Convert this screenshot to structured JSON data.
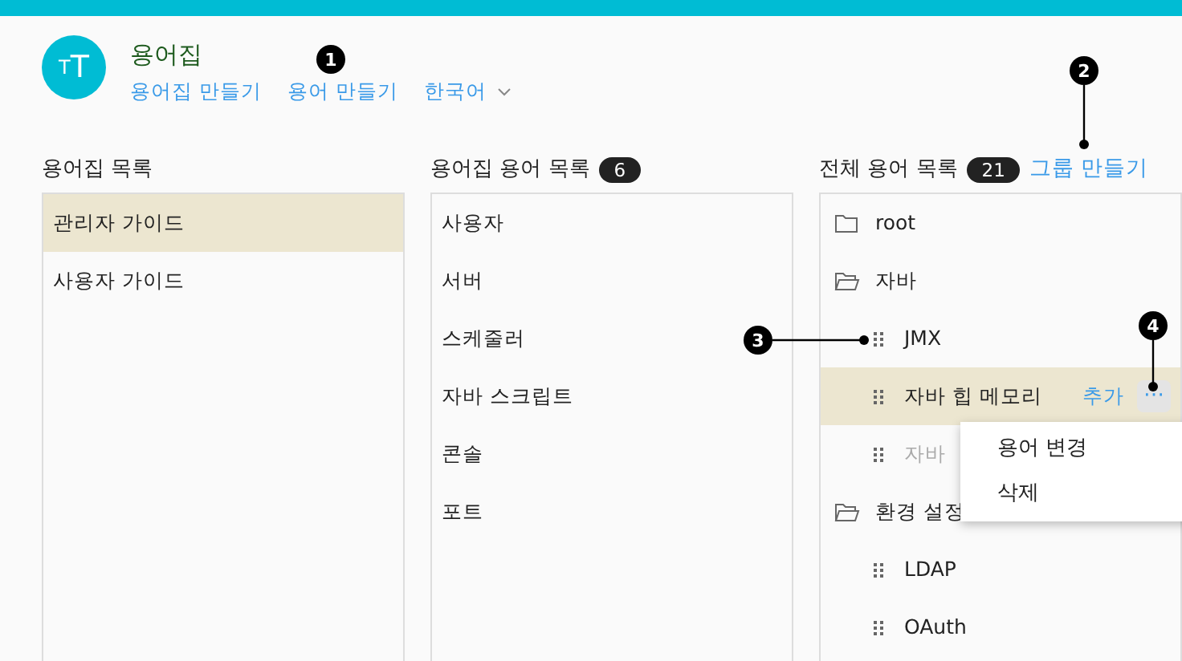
{
  "header": {
    "avatar": "TT",
    "title": "용어집",
    "links": [
      {
        "label": "용어집 만들기",
        "kind": "link"
      },
      {
        "label": "용어 만들기",
        "kind": "link"
      },
      {
        "label": "한국어",
        "kind": "dropdown"
      }
    ]
  },
  "glossary_list": {
    "title": "용어집 목록",
    "items": [
      {
        "label": "관리자 가이드",
        "selected": true
      },
      {
        "label": "사용자 가이드",
        "selected": false
      }
    ]
  },
  "term_list": {
    "title": "용어집 용어 목록",
    "count": "6",
    "items": [
      {
        "label": "사용자",
        "selected": false
      },
      {
        "label": "서버",
        "selected": false
      },
      {
        "label": "스케줄러",
        "selected": false
      },
      {
        "label": "자바 스크립트",
        "selected": false
      },
      {
        "label": "콘솔",
        "selected": false
      },
      {
        "label": "포트",
        "selected": false
      }
    ]
  },
  "all_terms": {
    "title": "전체 용어 목록",
    "count": "21",
    "action": "그룹 만들기",
    "tree": [
      {
        "kind": "folder",
        "label": "root",
        "expanded": false
      },
      {
        "kind": "folder",
        "label": "자바",
        "expanded": true,
        "children": [
          {
            "kind": "term",
            "label": "JMX",
            "selected": false,
            "disabled": false
          },
          {
            "kind": "term",
            "label": "자바 힙 메모리",
            "selected": true,
            "disabled": false,
            "add_link": "추가",
            "more": "⋯"
          },
          {
            "kind": "term",
            "label": "자바",
            "selected": false,
            "disabled": true
          }
        ]
      },
      {
        "kind": "folder",
        "label": "환경 설정",
        "expanded": true,
        "children": [
          {
            "kind": "term",
            "label": "LDAP",
            "selected": false,
            "disabled": false
          },
          {
            "kind": "term",
            "label": "OAuth",
            "selected": false,
            "disabled": false
          }
        ]
      }
    ]
  },
  "context_menu": {
    "items": [
      "용어 변경",
      "삭제"
    ]
  },
  "callouts": [
    "1",
    "2",
    "3",
    "4"
  ]
}
